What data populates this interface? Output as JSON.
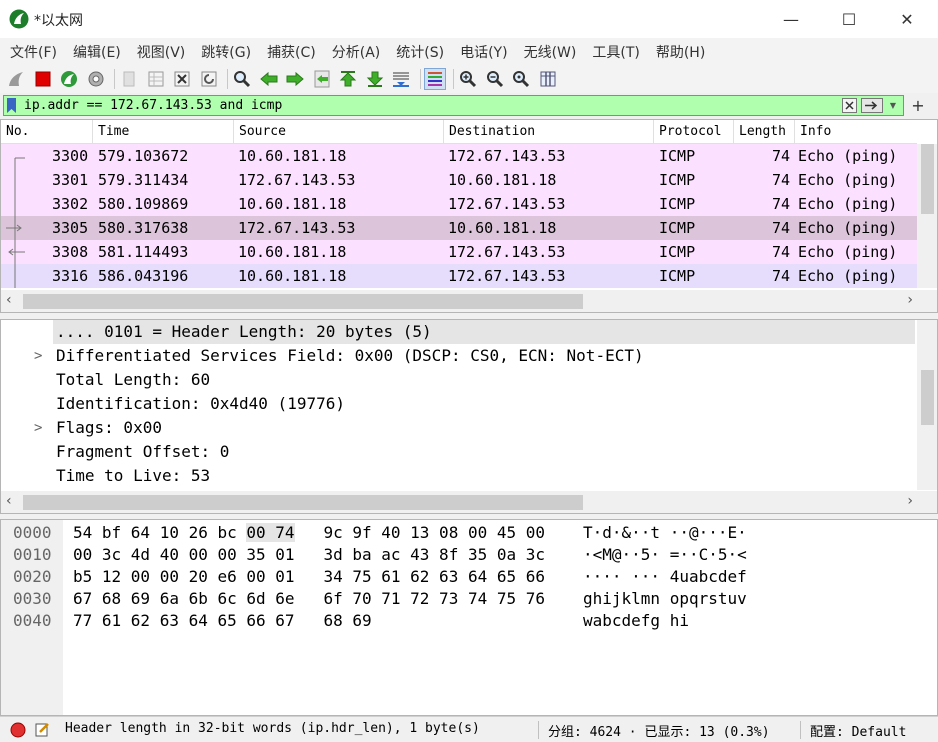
{
  "window": {
    "title": "*以太网",
    "controls": {
      "minimize": "—",
      "maximize": "☐",
      "close": "✕"
    }
  },
  "menu": [
    "文件(F)",
    "编辑(E)",
    "视图(V)",
    "跳转(G)",
    "捕获(C)",
    "分析(A)",
    "统计(S)",
    "电话(Y)",
    "无线(W)",
    "工具(T)",
    "帮助(H)"
  ],
  "filter": {
    "value": "ip.addr == 172.67.143.53 and icmp",
    "add_label": "+",
    "bg_color": "#afffaf"
  },
  "packet_list": {
    "columns": [
      "No.",
      "Time",
      "Source",
      "Destination",
      "Protocol",
      "Length",
      "Info"
    ],
    "rows": [
      {
        "no": "3300",
        "time": "579.103672",
        "src": "10.60.181.18",
        "dst": "172.67.143.53",
        "proto": "ICMP",
        "len": "74",
        "info": "Echo (ping)",
        "bg": "#fce0ff"
      },
      {
        "no": "3301",
        "time": "579.311434",
        "src": "172.67.143.53",
        "dst": "10.60.181.18",
        "proto": "ICMP",
        "len": "74",
        "info": "Echo (ping)",
        "bg": "#fce0ff"
      },
      {
        "no": "3302",
        "time": "580.109869",
        "src": "10.60.181.18",
        "dst": "172.67.143.53",
        "proto": "ICMP",
        "len": "74",
        "info": "Echo (ping)",
        "bg": "#fce0ff"
      },
      {
        "no": "3305",
        "time": "580.317638",
        "src": "172.67.143.53",
        "dst": "10.60.181.18",
        "proto": "ICMP",
        "len": "74",
        "info": "Echo (ping)",
        "bg": "#dcc5da"
      },
      {
        "no": "3308",
        "time": "581.114493",
        "src": "10.60.181.18",
        "dst": "172.67.143.53",
        "proto": "ICMP",
        "len": "74",
        "info": "Echo (ping)",
        "bg": "#fce0ff"
      },
      {
        "no": "3316",
        "time": "586.043196",
        "src": "10.60.181.18",
        "dst": "172.67.143.53",
        "proto": "ICMP",
        "len": "74",
        "info": "Echo (ping)",
        "bg": "#e6dcfc"
      }
    ]
  },
  "details": {
    "rows": [
      {
        "text": ".... 0101 = Header Length: 20 bytes (5)",
        "expander": "",
        "selected": true
      },
      {
        "text": "Differentiated Services Field: 0x00 (DSCP: CS0, ECN: Not-ECT)",
        "expander": ">",
        "selected": false
      },
      {
        "text": "Total Length: 60",
        "expander": "",
        "selected": false
      },
      {
        "text": "Identification: 0x4d40 (19776)",
        "expander": "",
        "selected": false
      },
      {
        "text": "Flags: 0x00",
        "expander": ">",
        "selected": false
      },
      {
        "text": "Fragment Offset: 0",
        "expander": "",
        "selected": false
      },
      {
        "text": "Time to Live: 53",
        "expander": "",
        "selected": false
      }
    ]
  },
  "bytes": {
    "rows": [
      {
        "offset": "0000",
        "hex1": "54 bf 64 10 26 bc ",
        "hexsel": "00 74",
        "hex2": "   9c 9f 40 13 08 00 45 00",
        "ascii": "T·d·&··t ··@···E·"
      },
      {
        "offset": "0010",
        "hex1": "00 3c 4d 40 00 00 35 01",
        "hexsel": "",
        "hex2": "   3d ba ac 43 8f 35 0a 3c",
        "ascii": "·<M@··5· =··C·5·<"
      },
      {
        "offset": "0020",
        "hex1": "b5 12 00 00 20 e6 00 01",
        "hexsel": "",
        "hex2": "   34 75 61 62 63 64 65 66",
        "ascii": "···· ··· 4uabcdef"
      },
      {
        "offset": "0030",
        "hex1": "67 68 69 6a 6b 6c 6d 6e",
        "hexsel": "",
        "hex2": "   6f 70 71 72 73 74 75 76",
        "ascii": "ghijklmn opqrstuv"
      },
      {
        "offset": "0040",
        "hex1": "77 61 62 63 64 65 66 67",
        "hexsel": "",
        "hex2": "   68 69",
        "ascii": "wabcdefg hi"
      }
    ]
  },
  "status": {
    "field_text": "Header length in 32-bit words (ip.hdr_len), 1 byte(s)",
    "packets": "分组: 4624 · 已显示: 13 (0.3%)",
    "profile": "配置: Default"
  }
}
